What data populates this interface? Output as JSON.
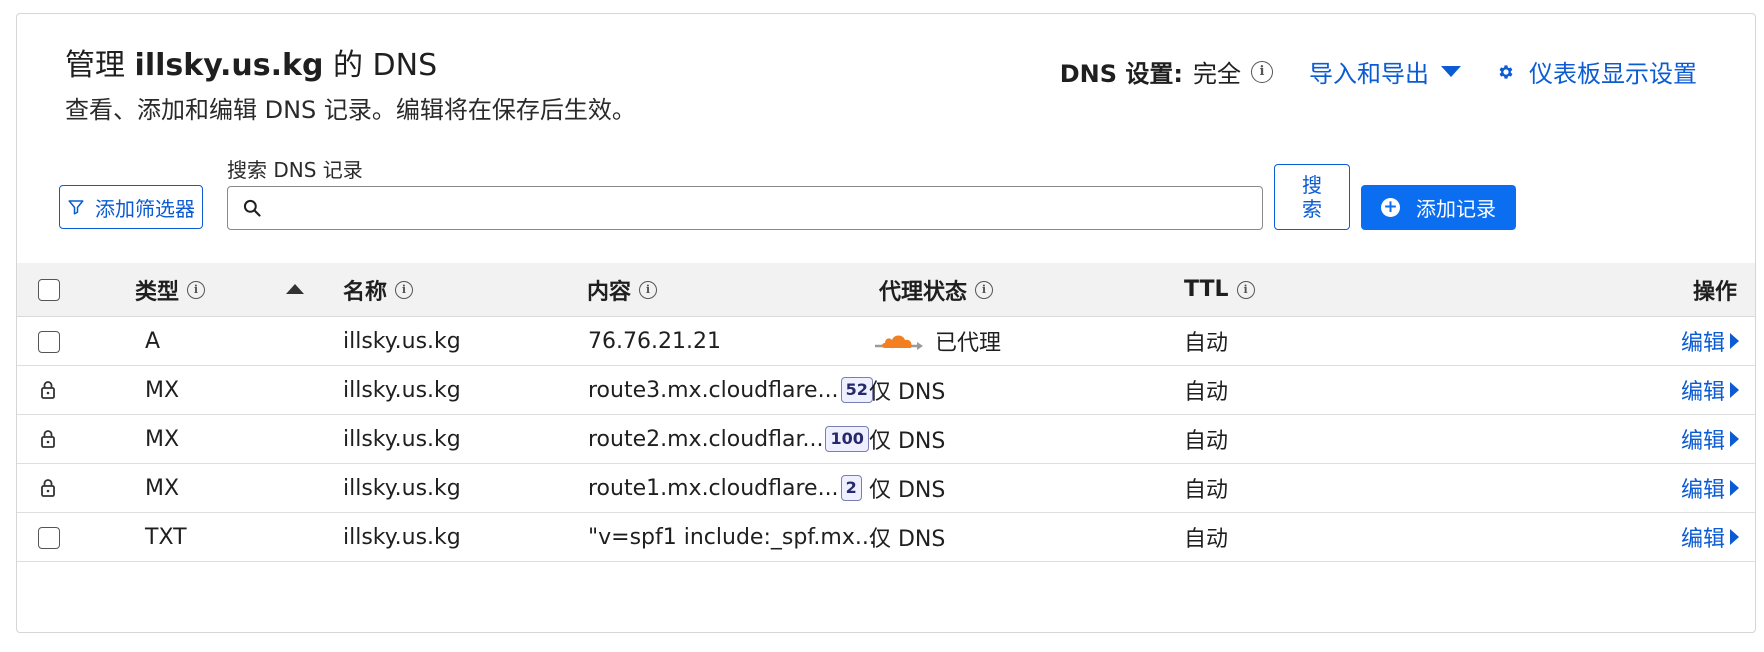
{
  "header": {
    "title_prefix": "管理",
    "title_domain": "illsky.us.kg",
    "title_suffix": "的 DNS",
    "subtitle": "查看、添加和编辑 DNS 记录。编辑将在保存后生效。",
    "dns_setting_label": "DNS 设置:",
    "dns_setting_value": "完全",
    "import_export_label": "导入和导出",
    "dashboard_settings_label": "仪表板显示设置"
  },
  "toolbar": {
    "filter_label": "添加筛选器",
    "search_label": "搜索 DNS 记录",
    "search_value": "",
    "search_button_label": "搜索",
    "add_record_label": "添加记录"
  },
  "table": {
    "columns": {
      "type": "类型",
      "name": "名称",
      "content": "内容",
      "proxy": "代理状态",
      "ttl": "TTL",
      "actions": "操作"
    },
    "rows": [
      {
        "type": "A",
        "name": "illsky.us.kg",
        "content": "76.76.21.21",
        "priority": "",
        "proxy": "已代理",
        "proxied": true,
        "locked": false,
        "ttl": "自动",
        "action": "编辑"
      },
      {
        "type": "MX",
        "name": "illsky.us.kg",
        "content": "route3.mx.cloudflare...",
        "priority": "52",
        "proxy": "仅 DNS",
        "proxied": false,
        "locked": true,
        "ttl": "自动",
        "action": "编辑"
      },
      {
        "type": "MX",
        "name": "illsky.us.kg",
        "content": "route2.mx.cloudflar...",
        "priority": "100",
        "proxy": "仅 DNS",
        "proxied": false,
        "locked": true,
        "ttl": "自动",
        "action": "编辑"
      },
      {
        "type": "MX",
        "name": "illsky.us.kg",
        "content": "route1.mx.cloudflare...",
        "priority": "2",
        "proxy": "仅 DNS",
        "proxied": false,
        "locked": true,
        "ttl": "自动",
        "action": "编辑"
      },
      {
        "type": "TXT",
        "name": "illsky.us.kg",
        "content": "\"v=spf1 include:_spf.mx...",
        "priority": "",
        "proxy": "仅 DNS",
        "proxied": false,
        "locked": false,
        "ttl": "自动",
        "action": "编辑"
      }
    ]
  },
  "colors": {
    "accent": "#0b5bd3",
    "primary_button": "#0b6ef0",
    "cloud_orange": "#f38020",
    "header_bg": "#f2f2f2"
  },
  "icons": [
    "info-icon",
    "caret-down-icon",
    "gear-icon",
    "filter-icon",
    "search-icon",
    "plus-circle-icon",
    "sort-ascending-icon",
    "lock-icon",
    "proxied-cloud-icon",
    "caret-right-icon"
  ]
}
